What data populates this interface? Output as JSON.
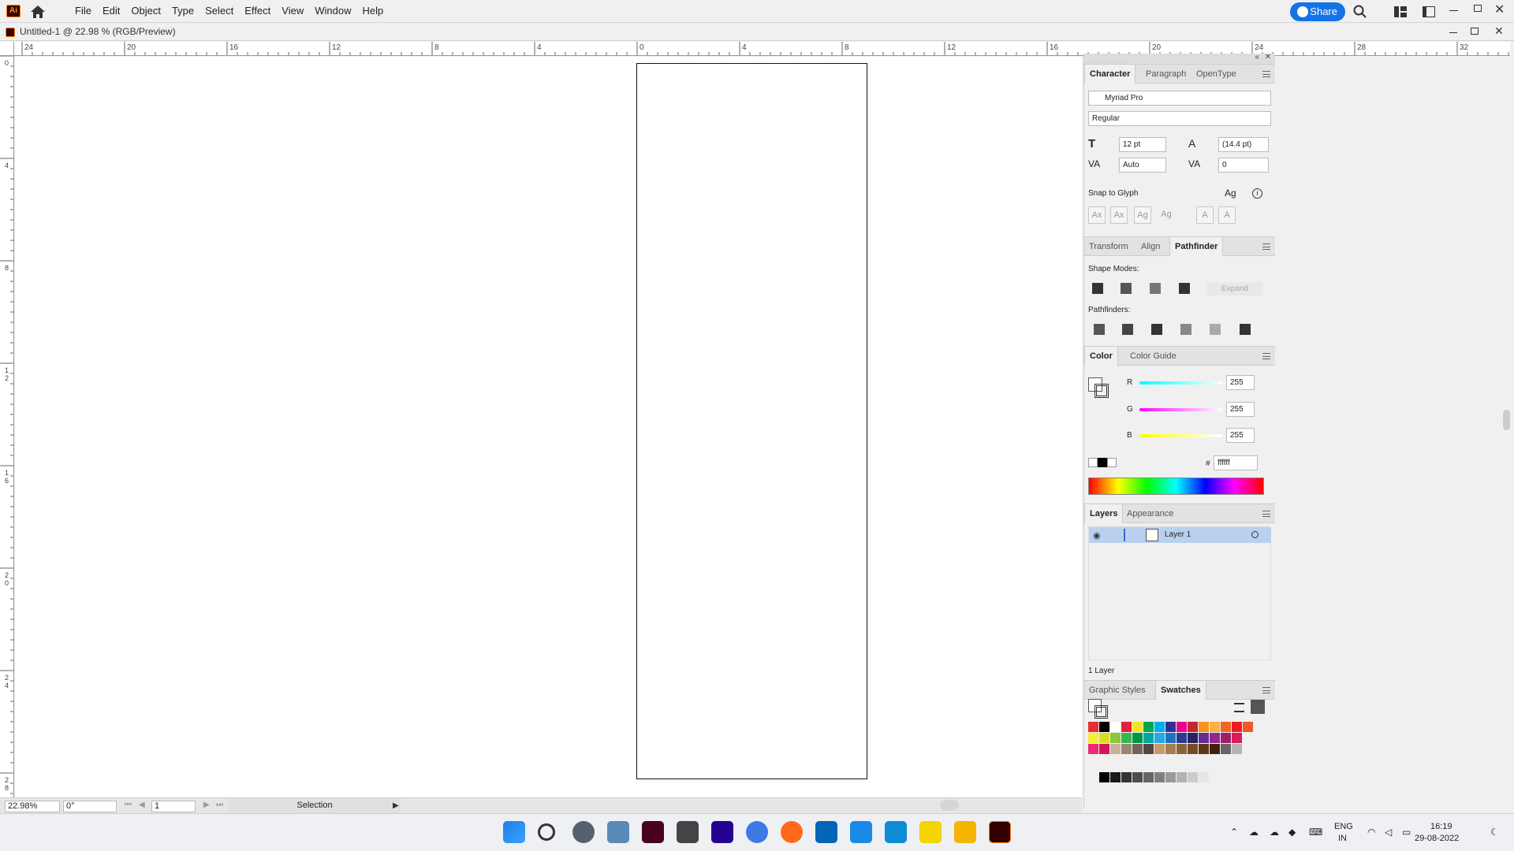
{
  "app": {
    "logo": "Ai",
    "menu": [
      "File",
      "Edit",
      "Object",
      "Type",
      "Select",
      "Effect",
      "View",
      "Window",
      "Help"
    ],
    "share_label": "Share",
    "document_title": "Untitled-1 @ 22.98 % (RGB/Preview)"
  },
  "ruler": {
    "h_labels": [
      "24",
      "20",
      "16",
      "12",
      "8",
      "4",
      "0",
      "4",
      "8",
      "12",
      "16",
      "20",
      "24",
      "28",
      "32"
    ],
    "v_labels": [
      "0",
      "4",
      "8",
      "1\n2",
      "1\n6",
      "2\n0",
      "2\n4",
      "2\n8"
    ]
  },
  "status": {
    "zoom": "22.98%",
    "rotation": "0°",
    "artboard_num": "1",
    "mode": "Selection"
  },
  "character": {
    "tabs": [
      "Character",
      "Paragraph",
      "OpenType"
    ],
    "font": "Myriad Pro",
    "style": "Regular",
    "size": "12 pt",
    "leading": "(14.4 pt)",
    "kerning": "Auto",
    "tracking": "0",
    "snap_label": "Snap to Glyph"
  },
  "pathfinder": {
    "tabs": [
      "Transform",
      "Align",
      "Pathfinder"
    ],
    "shape_modes_label": "Shape Modes:",
    "expand_label": "Expand",
    "pathfinders_label": "Pathfinders:"
  },
  "color": {
    "tabs": [
      "Color",
      "Color Guide"
    ],
    "r_label": "R",
    "r": "255",
    "g_label": "G",
    "g": "255",
    "b_label": "B",
    "b": "255",
    "hex_label": "#",
    "hex": "ffffff"
  },
  "layers": {
    "tabs": [
      "Layers",
      "Appearance"
    ],
    "layer_name": "Layer 1",
    "count": "1 Layer"
  },
  "swatches": {
    "tabs": [
      "Graphic Styles",
      "Swatches"
    ],
    "row1": [
      "#e62e2e",
      "#000000",
      "#ffffff",
      "#e61e3c",
      "#f5e51e",
      "#00a651",
      "#00aeef",
      "#2e3192",
      "#ec008c",
      "#c1272d",
      "#f7941d",
      "#fbb040",
      "#f26522",
      "#ed1c24",
      "#f15a24"
    ],
    "row2": [
      "#f9ed32",
      "#d7df23",
      "#8dc63f",
      "#39b54a",
      "#009444",
      "#00a79d",
      "#27aae1",
      "#1c75bc",
      "#2b3990",
      "#262262",
      "#662d91",
      "#92278f",
      "#9e1f63",
      "#da1c5c"
    ],
    "row3": [
      "#ee2a7b",
      "#d4145a",
      "#c7b299",
      "#998675",
      "#736357",
      "#534741",
      "#c69c6d",
      "#a67c52",
      "#8c6239",
      "#754c24",
      "#603813",
      "#42210b",
      "#666666",
      "#b3b3b3"
    ],
    "gray": [
      "#000000",
      "#1a1a1a",
      "#333333",
      "#4d4d4d",
      "#666666",
      "#808080",
      "#999999",
      "#b3b3b3",
      "#cccccc",
      "#e6e6e6"
    ]
  },
  "taskbar": {
    "lang": "ENG",
    "region": "IN",
    "time": "16:19",
    "date": "29-08-2022"
  }
}
